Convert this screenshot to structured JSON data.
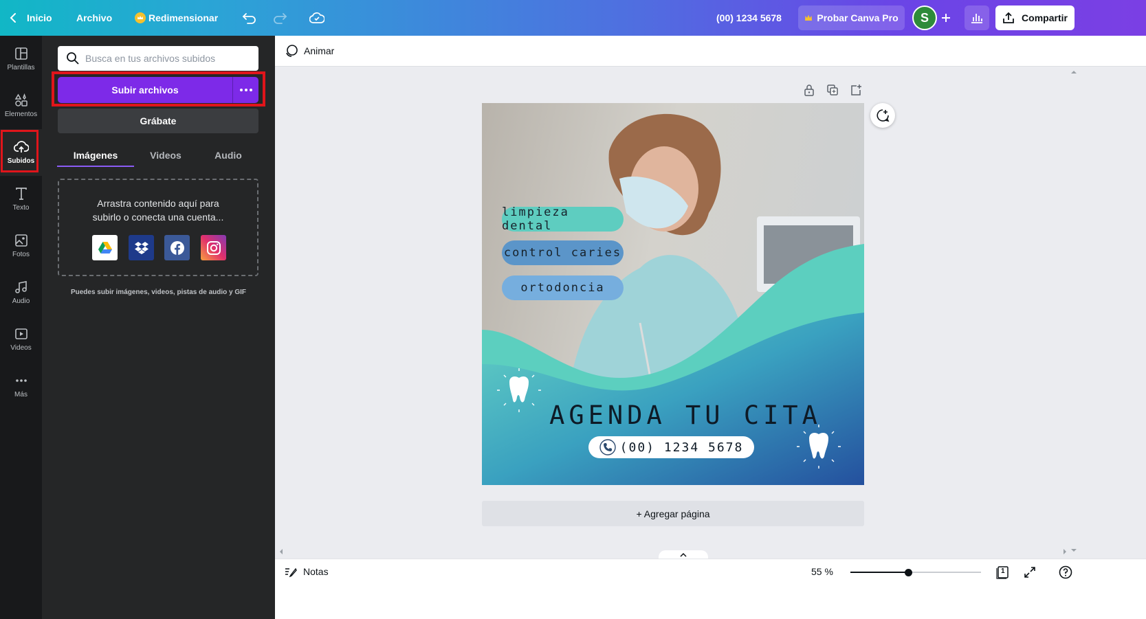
{
  "topbar": {
    "home_label": "Inicio",
    "file_label": "Archivo",
    "resize_label": "Redimensionar",
    "phone_title": "(00) 1234 5678",
    "pro_label": "Probar Canva Pro",
    "avatar_initial": "S",
    "share_label": "Compartir"
  },
  "rail": {
    "items": [
      {
        "label": "Plantillas",
        "icon": "templates-icon"
      },
      {
        "label": "Elementos",
        "icon": "elements-icon"
      },
      {
        "label": "Subidos",
        "icon": "upload-cloud-icon"
      },
      {
        "label": "Texto",
        "icon": "text-icon"
      },
      {
        "label": "Fotos",
        "icon": "photos-icon"
      },
      {
        "label": "Audio",
        "icon": "audio-icon"
      },
      {
        "label": "Videos",
        "icon": "videos-icon"
      },
      {
        "label": "Más",
        "icon": "more-icon"
      }
    ],
    "active_index": 2
  },
  "panel": {
    "search_placeholder": "Busca en tus archivos subidos",
    "upload_label": "Subir archivos",
    "record_label": "Grábate",
    "tabs": [
      "Imágenes",
      "Videos",
      "Audio"
    ],
    "active_tab": "Imágenes",
    "dropzone_line1": "Arrastra contenido aquí para",
    "dropzone_line2": "subirlo o conecta una cuenta...",
    "services": [
      "google-drive-icon",
      "dropbox-icon",
      "facebook-icon",
      "instagram-icon"
    ],
    "hint": "Puedes subir imágenes, videos, pistas de audio y GIF"
  },
  "editor": {
    "animate_label": "Animar",
    "add_page_label": "+ Agregar página",
    "notes_label": "Notas",
    "zoom": "55 %",
    "zoom_fraction": 0.44,
    "page_number": "1"
  },
  "design": {
    "services": [
      "limpieza dental",
      "control caries",
      "ortodoncia"
    ],
    "headline": "AGENDA TU CITA",
    "phone": "(00) 1234 5678",
    "colors": {
      "teal": "#5fcfc0",
      "blue": "#2c6eb6",
      "pill_teal": "#5ecdc0",
      "pill_blue": "#6aa3d6"
    }
  },
  "colors": {
    "accent": "#7d2ae8",
    "highlight_box": "#e0151b",
    "rail_bg": "#18191b",
    "panel_bg": "#252627"
  }
}
